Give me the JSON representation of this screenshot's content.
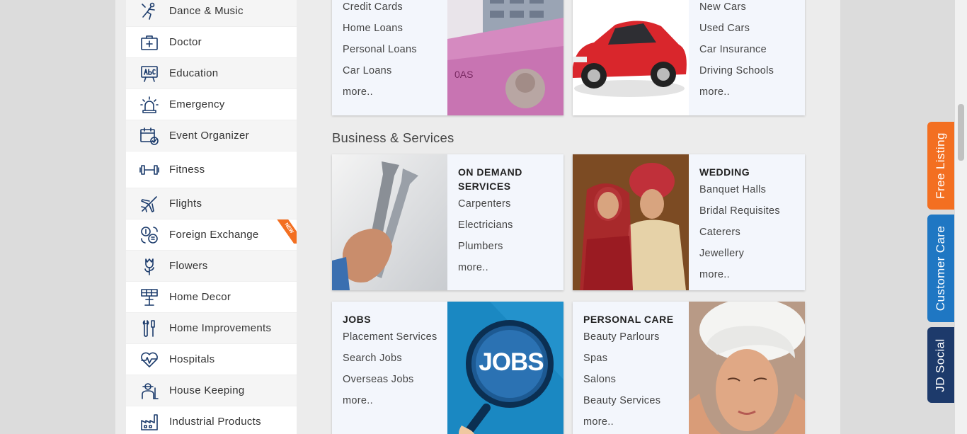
{
  "sidebar": {
    "items": [
      {
        "label": "Dance & Music",
        "icon": "dancer-icon"
      },
      {
        "label": "Doctor",
        "icon": "medical-kit-icon"
      },
      {
        "label": "Education",
        "icon": "abc-board-icon"
      },
      {
        "label": "Emergency",
        "icon": "siren-icon"
      },
      {
        "label": "Event Organizer",
        "icon": "calendar-check-icon"
      },
      {
        "label": "Fitness",
        "icon": "dumbbell-icon"
      },
      {
        "label": "Flights",
        "icon": "airplane-icon"
      },
      {
        "label": "Foreign Exchange",
        "icon": "currency-exchange-icon",
        "badge": "NEW"
      },
      {
        "label": "Flowers",
        "icon": "flower-icon"
      },
      {
        "label": "Home Decor",
        "icon": "lamp-icon"
      },
      {
        "label": "Home Improvements",
        "icon": "tools-icon"
      },
      {
        "label": "Hospitals",
        "icon": "heart-pulse-icon"
      },
      {
        "label": "House Keeping",
        "icon": "housekeeper-icon"
      },
      {
        "label": "Industrial Products",
        "icon": "factory-icon"
      }
    ]
  },
  "cards_top": {
    "loans": {
      "links": [
        "Credit Cards",
        "Home Loans",
        "Personal Loans",
        "Car Loans",
        "more.."
      ]
    },
    "automobile": {
      "links": [
        "New Cars",
        "Used Cars",
        "Car Insurance",
        "Driving Schools",
        "more.."
      ]
    }
  },
  "section": {
    "title": "Business & Services"
  },
  "cards": {
    "on_demand": {
      "title": "ON DEMAND SERVICES",
      "links": [
        "Carpenters",
        "Electricians",
        "Plumbers",
        "more.."
      ]
    },
    "wedding": {
      "title": "WEDDING",
      "links": [
        "Banquet Halls",
        "Bridal Requisites",
        "Caterers",
        "Jewellery",
        "more.."
      ]
    },
    "jobs": {
      "title": "JOBS",
      "links": [
        "Placement Services",
        "Search Jobs",
        "Overseas Jobs",
        "more.."
      ],
      "image_text": "JOBS"
    },
    "personal_care": {
      "title": "PERSONAL CARE",
      "links": [
        "Beauty Parlours",
        "Spas",
        "Salons",
        "Beauty Services",
        "more.."
      ]
    }
  },
  "tabs": {
    "free_listing": "Free Listing",
    "customer_care": "Customer Care",
    "jd_social": "JD Social"
  },
  "colors": {
    "free_listing": "#f36f21",
    "customer_care": "#1f77c3",
    "jd_social": "#1d3a6b",
    "icon": "#1a3a6b"
  }
}
